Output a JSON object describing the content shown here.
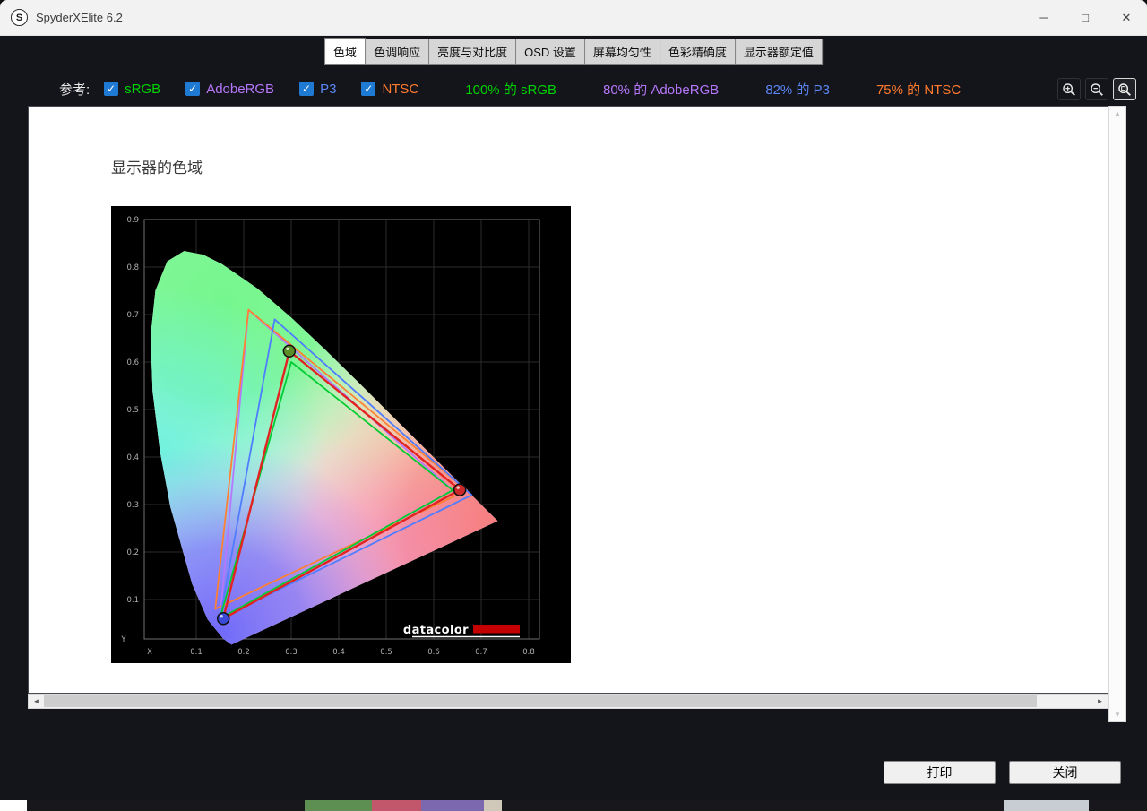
{
  "window": {
    "title": "SpyderXElite 6.2",
    "logo_letter": "S",
    "controls": {
      "minimize": "─",
      "maximize": "□",
      "close": "✕"
    }
  },
  "tabs": [
    {
      "label": "色域",
      "selected": true
    },
    {
      "label": "色调响应",
      "selected": false
    },
    {
      "label": "亮度与对比度",
      "selected": false
    },
    {
      "label": "OSD 设置",
      "selected": false
    },
    {
      "label": "屏幕均匀性",
      "selected": false
    },
    {
      "label": "色彩精确度",
      "selected": false
    },
    {
      "label": "显示器额定值",
      "selected": false
    }
  ],
  "reference": {
    "label": "参考:",
    "check_glyph": "✓",
    "options": [
      {
        "label": "sRGB",
        "checked": true,
        "color": "#00d400"
      },
      {
        "label": "AdobeRGB",
        "checked": true,
        "color": "#b678fa"
      },
      {
        "label": "P3",
        "checked": true,
        "color": "#5b86f2"
      },
      {
        "label": "NTSC",
        "checked": true,
        "color": "#ff7b2e"
      }
    ],
    "results": [
      {
        "text": "100% 的 sRGB",
        "color": "#00d400"
      },
      {
        "text": "80% 的 AdobeRGB",
        "color": "#b678fa"
      },
      {
        "text": "82% 的 P3",
        "color": "#5b86f2"
      },
      {
        "text": "75% 的 NTSC",
        "color": "#ff7b2e"
      }
    ]
  },
  "toolbar": {
    "zoom_buttons": [
      "zoom-in",
      "zoom-out",
      "zoom-fit"
    ]
  },
  "report": {
    "heading": "显示器的色域",
    "logo_text": "datacolor"
  },
  "chart_data": {
    "type": "scatter",
    "title": "CIE 1931 xy chromaticity diagram with gamut triangles",
    "xlabel": "X",
    "ylabel": "Y",
    "xlim": [
      0,
      0.85
    ],
    "ylim": [
      0,
      0.92
    ],
    "xticks": [
      0.1,
      0.2,
      0.3,
      0.4,
      0.5,
      0.6,
      0.7,
      0.8
    ],
    "yticks": [
      0.1,
      0.2,
      0.3,
      0.4,
      0.5,
      0.6,
      0.7,
      0.8,
      0.9
    ],
    "grid": true,
    "legend_position": "none",
    "spectral_locus": [
      [
        0.1741,
        0.005
      ],
      [
        0.1566,
        0.0177
      ],
      [
        0.1241,
        0.0578
      ],
      [
        0.0913,
        0.1327
      ],
      [
        0.0454,
        0.295
      ],
      [
        0.0235,
        0.4127
      ],
      [
        0.0082,
        0.5384
      ],
      [
        0.0039,
        0.6548
      ],
      [
        0.0139,
        0.7502
      ],
      [
        0.0389,
        0.812
      ],
      [
        0.0743,
        0.8338
      ],
      [
        0.1142,
        0.8262
      ],
      [
        0.1547,
        0.8059
      ],
      [
        0.2296,
        0.7543
      ],
      [
        0.3016,
        0.6923
      ],
      [
        0.3731,
        0.6245
      ],
      [
        0.4441,
        0.5547
      ],
      [
        0.5125,
        0.4866
      ],
      [
        0.5752,
        0.4242
      ],
      [
        0.627,
        0.3725
      ],
      [
        0.6658,
        0.334
      ],
      [
        0.6915,
        0.3083
      ],
      [
        0.714,
        0.2859
      ],
      [
        0.7347,
        0.2653
      ]
    ],
    "gamuts": [
      {
        "name": "AdobeRGB",
        "color": "#b478ff",
        "vertices": [
          [
            0.64,
            0.33
          ],
          [
            0.21,
            0.71
          ],
          [
            0.15,
            0.06
          ]
        ]
      },
      {
        "name": "NTSC",
        "color": "#ff8033",
        "vertices": [
          [
            0.67,
            0.33
          ],
          [
            0.21,
            0.71
          ],
          [
            0.14,
            0.08
          ]
        ]
      },
      {
        "name": "P3",
        "color": "#4f7dff",
        "vertices": [
          [
            0.68,
            0.32
          ],
          [
            0.265,
            0.69
          ],
          [
            0.15,
            0.06
          ]
        ]
      },
      {
        "name": "sRGB",
        "color": "#00cc33",
        "vertices": [
          [
            0.64,
            0.33
          ],
          [
            0.3,
            0.6
          ],
          [
            0.15,
            0.06
          ]
        ]
      },
      {
        "name": "display",
        "color": "#e32222",
        "vertices": [
          [
            0.655,
            0.331
          ],
          [
            0.296,
            0.623
          ],
          [
            0.157,
            0.06
          ]
        ],
        "markers": [
          "#cc2a2a",
          "#5a8f28",
          "#3b49d8"
        ]
      }
    ]
  },
  "footer": {
    "print_label": "打印",
    "close_label": "关闭"
  }
}
